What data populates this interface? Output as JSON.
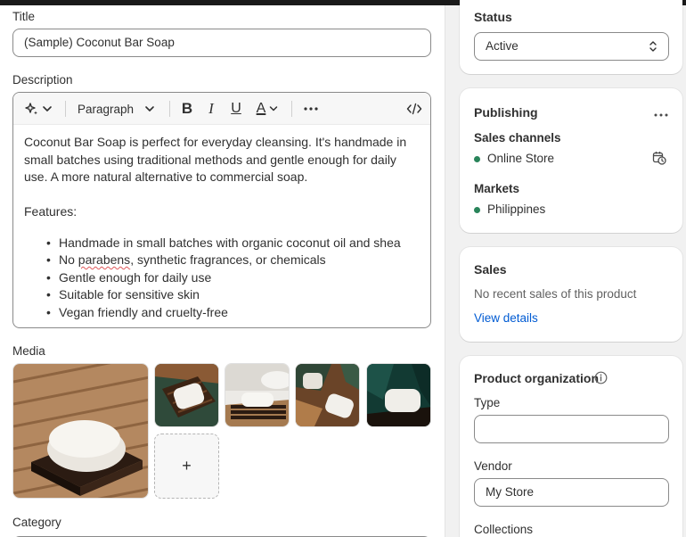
{
  "title_section": {
    "label": "Title",
    "value": "(Sample) Coconut Bar Soap"
  },
  "description_section": {
    "label": "Description",
    "toolbar": {
      "ai_icon": "sparkle-icon",
      "paragraph_label": "Paragraph",
      "bold_label": "B",
      "italic_label": "I",
      "underline_label": "U",
      "text_color_label": "A",
      "more_icon": "more-horizontal-icon",
      "code_icon": "code-icon"
    },
    "paragraph": "Coconut Bar Soap is perfect for everyday cleansing. It's handmade in small batches using traditional methods and gentle enough for daily use. A more natural alternative to commercial soap.",
    "features_heading": "Features:",
    "bullet_1": "Handmade in small batches with organic coconut oil and shea",
    "bullet_2_prefix": "No ",
    "bullet_2_misspelled": "parabens",
    "bullet_2_suffix": ", synthetic fragrances, or chemicals",
    "bullet_3": "Gentle enough for daily use",
    "bullet_4": "Suitable for sensitive skin",
    "bullet_5": "Vegan friendly and cruelty-free"
  },
  "media_section": {
    "label": "Media",
    "add_label": "+"
  },
  "category_section": {
    "label": "Category"
  },
  "status_card": {
    "title": "Status",
    "selected": "Active"
  },
  "publishing_card": {
    "title": "Publishing",
    "sales_channels_label": "Sales channels",
    "channel": "Online Store",
    "markets_label": "Markets",
    "market": "Philippines",
    "status_dot_color": "#29845a"
  },
  "sales_card": {
    "title": "Sales",
    "message": "No recent sales of this product",
    "link": "View details"
  },
  "organization_card": {
    "title": "Product organization",
    "type_label": "Type",
    "type_value": "",
    "vendor_label": "Vendor",
    "vendor_value": "My Store",
    "collections_label": "Collections"
  }
}
